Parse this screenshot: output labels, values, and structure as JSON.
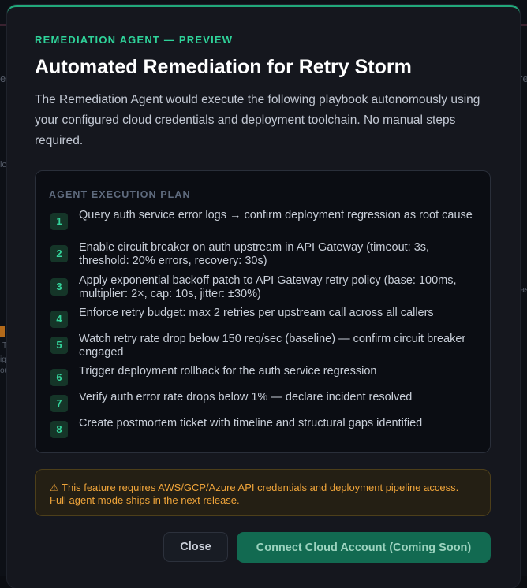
{
  "background": {
    "fragments": [
      "er",
      "re",
      "as",
      "T",
      "ig",
      "ou",
      "ic"
    ]
  },
  "modal": {
    "eyebrow": "REMEDIATION AGENT — PREVIEW",
    "title": "Automated Remediation for Retry Storm",
    "description": "The Remediation Agent would execute the following playbook autonomously using your configured cloud credentials and deployment toolchain. No manual steps required.",
    "plan": {
      "title": "AGENT EXECUTION PLAN",
      "steps": [
        {
          "num": "1",
          "text": "Query auth service error logs → confirm deployment regression as root cause"
        },
        {
          "num": "2",
          "text": "Enable circuit breaker on auth upstream in API Gateway (timeout: 3s, threshold: 20% errors, recovery: 30s)"
        },
        {
          "num": "3",
          "text": "Apply exponential backoff patch to API Gateway retry policy (base: 100ms, multiplier: 2×, cap: 10s, jitter: ±30%)"
        },
        {
          "num": "4",
          "text": "Enforce retry budget: max 2 retries per upstream call across all callers"
        },
        {
          "num": "5",
          "text": "Watch retry rate drop below 150 req/sec (baseline) — confirm circuit breaker engaged"
        },
        {
          "num": "6",
          "text": "Trigger deployment rollback for the auth service regression"
        },
        {
          "num": "7",
          "text": "Verify auth error rate drops below 1% — declare incident resolved"
        },
        {
          "num": "8",
          "text": "Create postmortem ticket with timeline and structural gaps identified"
        }
      ]
    },
    "warning": "⚠ This feature requires AWS/GCP/Azure API credentials and deployment pipeline access. Full agent mode ships in the next release.",
    "buttons": {
      "close": "Close",
      "connect": "Connect Cloud Account (Coming Soon)"
    }
  },
  "colors": {
    "accent": "#2fd39a",
    "warning": "#f0a53a",
    "primary_button": "#126a51"
  }
}
